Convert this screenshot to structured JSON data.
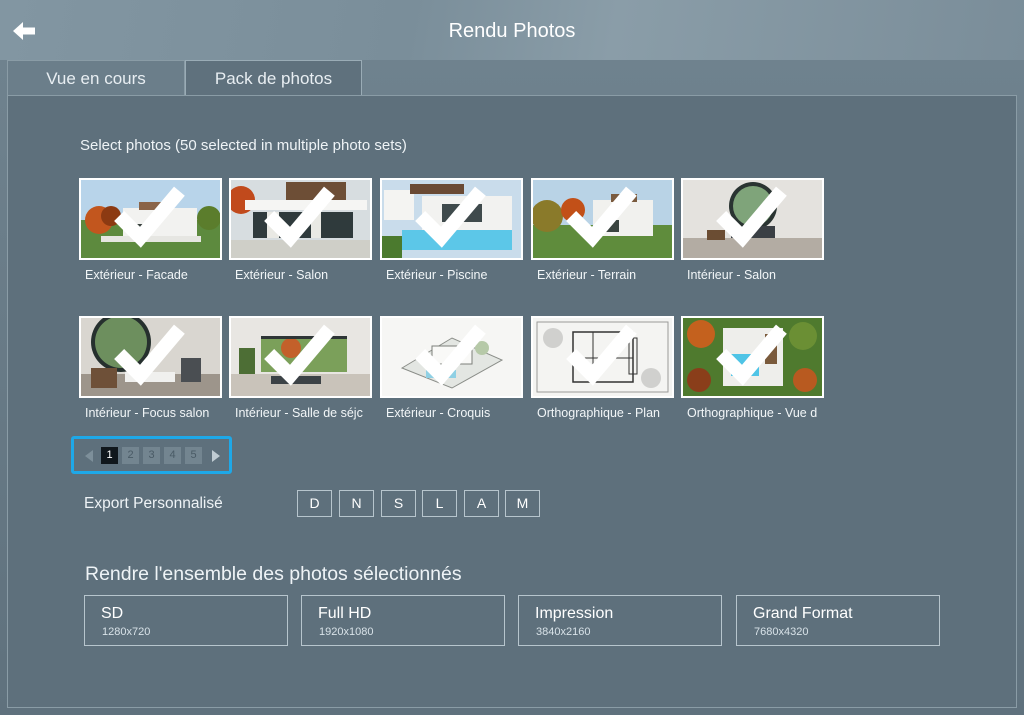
{
  "window": {
    "title": "Rendu Photos"
  },
  "tabs": [
    {
      "label": "Vue en cours"
    },
    {
      "label": "Pack de photos"
    }
  ],
  "select_label": "Select photos (50 selected in multiple photo sets)",
  "photos": [
    {
      "label": "Extérieur - Facade",
      "selected": true,
      "scene": "exterior-facade"
    },
    {
      "label": "Extérieur - Salon",
      "selected": true,
      "scene": "exterior-salon"
    },
    {
      "label": "Extérieur - Piscine",
      "selected": true,
      "scene": "exterior-pool"
    },
    {
      "label": "Extérieur - Terrain",
      "selected": true,
      "scene": "exterior-terrain"
    },
    {
      "label": "Intérieur - Salon",
      "selected": true,
      "scene": "interior-salon"
    },
    {
      "label": "Intérieur - Focus salon",
      "selected": true,
      "scene": "interior-focus"
    },
    {
      "label": "Intérieur - Salle de séjc",
      "selected": true,
      "scene": "interior-living"
    },
    {
      "label": "Extérieur - Croquis",
      "selected": true,
      "scene": "sketch"
    },
    {
      "label": "Orthographique - Plan",
      "selected": true,
      "scene": "plan"
    },
    {
      "label": "Orthographique - Vue d",
      "selected": true,
      "scene": "top-view"
    }
  ],
  "pagination": {
    "pages": [
      "1",
      "2",
      "3",
      "4",
      "5"
    ],
    "current": "1"
  },
  "export": {
    "label": "Export Personnalisé",
    "buttons": [
      "D",
      "N",
      "S",
      "L",
      "A",
      "M"
    ]
  },
  "render": {
    "heading": "Rendre l'ensemble des photos sélectionnés",
    "options": [
      {
        "name": "SD",
        "size": "1280x720"
      },
      {
        "name": "Full HD",
        "size": "1920x1080"
      },
      {
        "name": "Impression",
        "size": "3840x2160"
      },
      {
        "name": "Grand Format",
        "size": "7680x4320"
      }
    ]
  },
  "colors": {
    "accent": "#1ea8e8",
    "background": "#5e707c",
    "titlebar": "#7d909c"
  },
  "icons": {
    "back": "arrow-left-icon",
    "check": "checkmark-icon",
    "prev": "triangle-left-icon",
    "next": "triangle-right-icon"
  }
}
